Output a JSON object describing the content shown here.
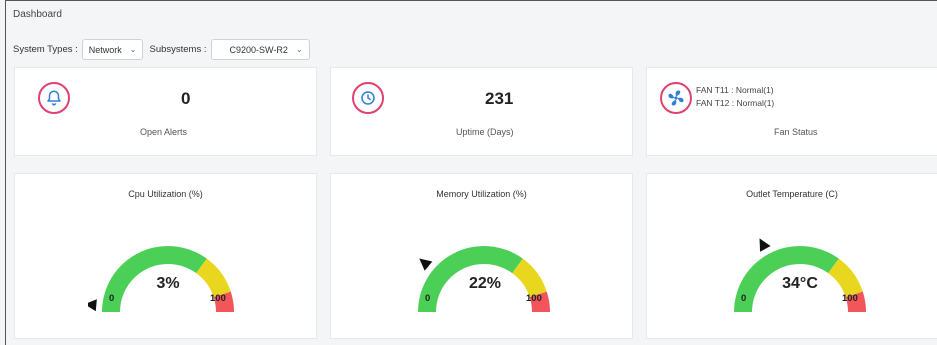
{
  "header": {
    "title": "Dashboard"
  },
  "filters": {
    "system_types_label": "System Types :",
    "system_type_value": "Network",
    "subsystems_label": "Subsystems :",
    "subsystem_value": "C9200-SW-R2"
  },
  "stats": {
    "alerts": {
      "value": "0",
      "label": "Open Alerts",
      "icon": "bell-icon"
    },
    "uptime": {
      "value": "231",
      "label": "Uptime (Days)",
      "icon": "clock-icon"
    },
    "fan": {
      "lines": [
        "FAN T11 : Normal(1)",
        "FAN T12 : Normal(1)"
      ],
      "label": "Fan Status",
      "icon": "fan-icon"
    }
  },
  "gauges": [
    {
      "title": "Cpu Utilization (%)",
      "value_text": "3%",
      "value": 3,
      "min": "0",
      "max": "100"
    },
    {
      "title": "Memory Utilization (%)",
      "value_text": "22%",
      "value": 22,
      "min": "0",
      "max": "100"
    },
    {
      "title": "Outlet Temperature (C)",
      "value_text": "34°C",
      "value": 34,
      "min": "0",
      "max": "100"
    }
  ],
  "colors": {
    "accent_ring": "#e0416d",
    "icon_blue": "#2f7fd6",
    "gauge_green": "#4ccf57",
    "gauge_yellow": "#e9d61f",
    "gauge_red": "#f2565a"
  }
}
